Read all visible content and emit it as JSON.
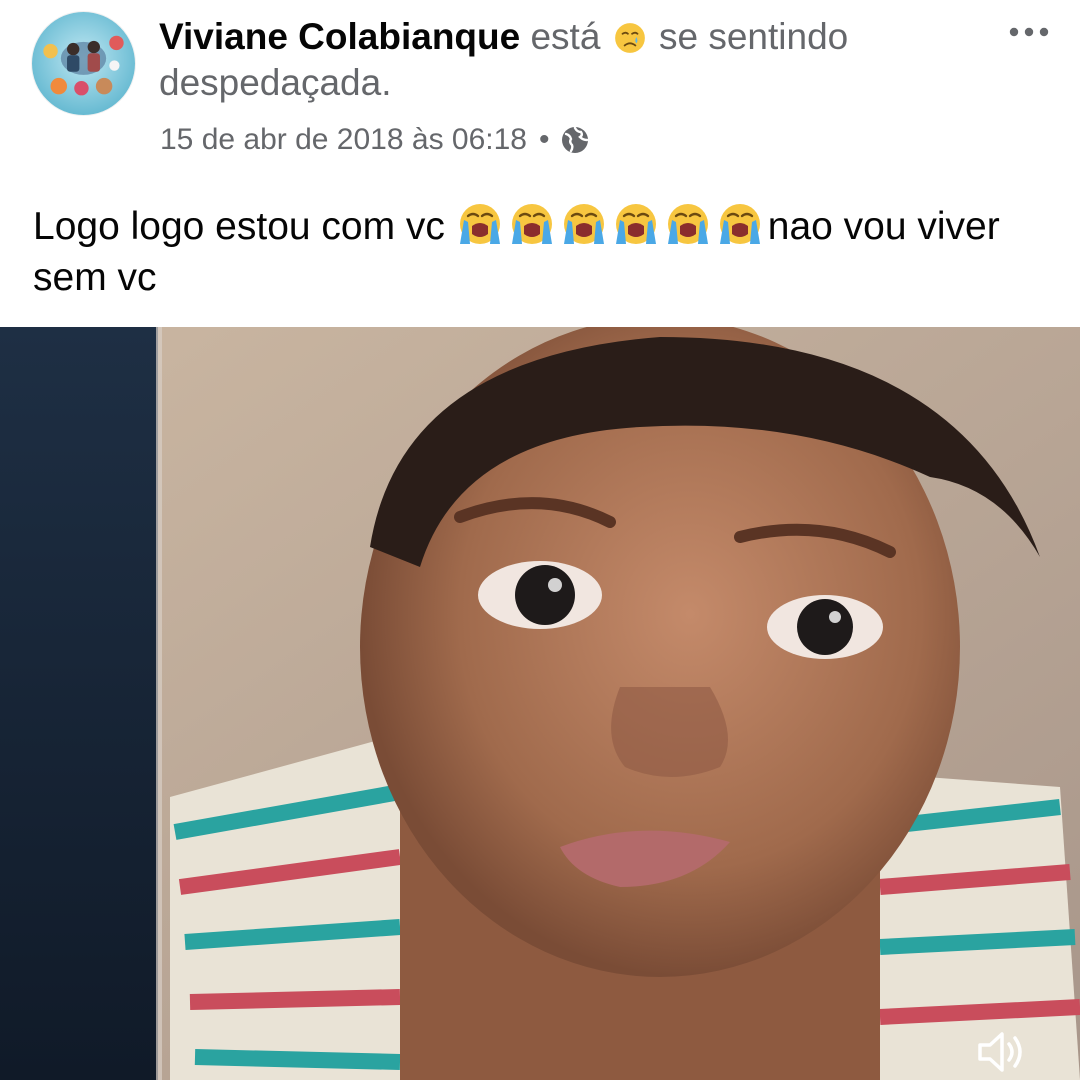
{
  "post": {
    "author": "Viviane Colabianque",
    "feeling_prefix": "está",
    "feeling_emoji": "face-with-tear-icon",
    "feeling_text": "se sentindo despedaçada.",
    "timestamp": "15 de abr de 2018 às 06:18",
    "separator": "•",
    "privacy_icon": "globe-icon",
    "text_before_emojis": "Logo logo estou com vc ",
    "emoji_name": "loudly-crying-face-icon",
    "emoji_count": 6,
    "text_after_emojis": "nao vou viver sem vc",
    "more_icon": "more-horizontal-icon",
    "media_type": "video",
    "volume_icon": "volume-icon"
  },
  "colors": {
    "author_text": "#050505",
    "secondary_text": "#65676b",
    "background": "#ffffff"
  }
}
